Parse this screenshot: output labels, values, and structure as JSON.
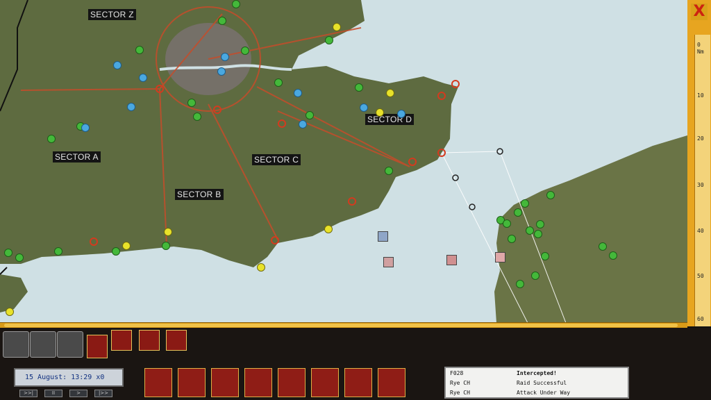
{
  "map": {
    "sectors": [
      "SECTOR Z",
      "SECTOR A",
      "SECTOR B",
      "SECTOR C",
      "SECTOR D"
    ],
    "colors": {
      "land": "#5d6d3f",
      "sea": "#cfe0e4",
      "france": "#6a7446",
      "roads": "#c64c2a"
    }
  },
  "scale": {
    "close_icon": "close-icon",
    "close_glyph": "X",
    "unit": "Nm",
    "ticks": [
      "0",
      "10",
      "20",
      "30",
      "40",
      "50",
      "60"
    ]
  },
  "toolbar": {
    "top_buttons": [
      "telephone-icon",
      "telephone-icon",
      "telephone-icon",
      "raid-map-icon",
      "squadron-icon",
      "report-icon",
      "play-icon"
    ],
    "bottom_buttons": [
      "gauge-icon",
      "hierarchy-icon",
      "aircraft-icon",
      "flag-icon",
      "newspaper-icon",
      "pilot-portrait-icon",
      "hangar-icon",
      "radio-icon"
    ]
  },
  "clock": {
    "date_time": "15 August: 13:29 x0",
    "controls": [
      ">>|",
      "II",
      ">",
      "|>>"
    ]
  },
  "log": {
    "rows": [
      {
        "source": "F028",
        "message": "Intercepted!"
      },
      {
        "source": "Rye CH",
        "message": "Raid Successful"
      },
      {
        "source": "Rye CH",
        "message": "Attack Under Way"
      }
    ]
  }
}
